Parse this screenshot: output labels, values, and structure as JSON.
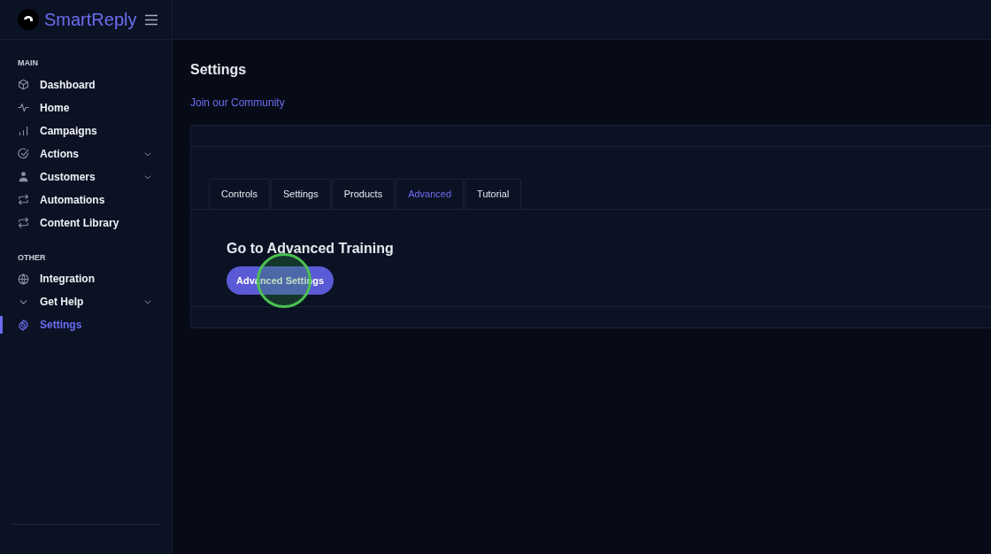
{
  "brand": {
    "name": "SmartReply"
  },
  "sidebar": {
    "sections": [
      {
        "heading": "MAIN",
        "items": [
          {
            "label": "Dashboard",
            "has_submenu": false,
            "selected": false
          },
          {
            "label": "Home",
            "has_submenu": false,
            "selected": false
          },
          {
            "label": "Campaigns",
            "has_submenu": false,
            "selected": false
          },
          {
            "label": "Actions",
            "has_submenu": true,
            "selected": false
          },
          {
            "label": "Customers",
            "has_submenu": true,
            "selected": false
          },
          {
            "label": "Automations",
            "has_submenu": false,
            "selected": false
          },
          {
            "label": "Content Library",
            "has_submenu": false,
            "selected": false
          }
        ]
      },
      {
        "heading": "OTHER",
        "items": [
          {
            "label": "Integration",
            "has_submenu": false,
            "selected": false
          },
          {
            "label": "Get Help",
            "has_submenu": true,
            "selected": false
          },
          {
            "label": "Settings",
            "has_submenu": false,
            "selected": true
          }
        ]
      }
    ]
  },
  "page": {
    "title": "Settings",
    "community_link": "Join our Community"
  },
  "tabs": [
    {
      "label": "Controls",
      "selected": false
    },
    {
      "label": "Settings",
      "selected": false
    },
    {
      "label": "Products",
      "selected": false
    },
    {
      "label": "Advanced",
      "selected": true
    },
    {
      "label": "Tutorial",
      "selected": false
    }
  ],
  "panel": {
    "heading": "Go to Advanced Training",
    "button": "Advanced Settings",
    "click_marker": true
  }
}
